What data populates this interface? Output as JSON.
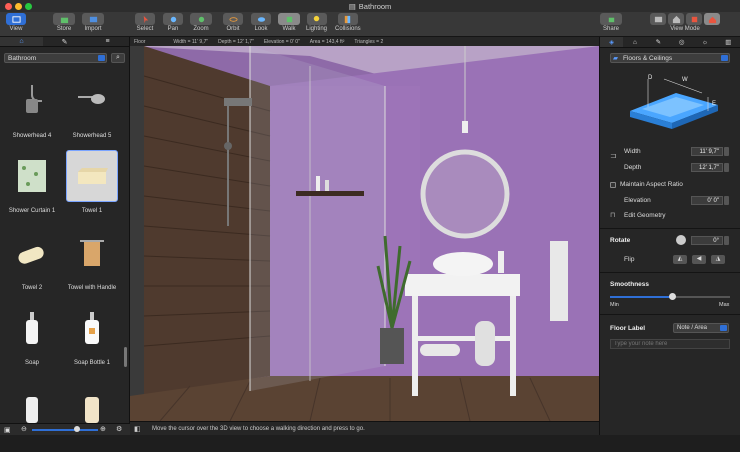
{
  "window": {
    "title": "Bathroom"
  },
  "toolbar": {
    "view": "View",
    "store": "Store",
    "import": "Import",
    "select": "Select",
    "pan": "Pan",
    "zoom": "Zoom",
    "orbit": "Orbit",
    "look": "Look",
    "walk": "Walk",
    "lighting": "Lighting",
    "collisions": "Collisions",
    "share": "Share",
    "viewmode": "View Mode"
  },
  "status": {
    "floor": "Floor",
    "width": "Width = 11' 9,7\"",
    "depth": "Depth = 12' 1,7\"",
    "elevation": "Elevation = 0' 0\"",
    "area": "Area = 143,4 ft²",
    "triangles": "Triangles = 2"
  },
  "library": {
    "category": "Bathroom",
    "items": [
      {
        "label": "Showerhead 4"
      },
      {
        "label": "Showerhead 5"
      },
      {
        "label": "Shower Curtain 1"
      },
      {
        "label": "Towel 1"
      },
      {
        "label": "Towel 2"
      },
      {
        "label": "Towel with Handle"
      },
      {
        "label": "Soap"
      },
      {
        "label": "Soap Bottle 1"
      }
    ]
  },
  "hint": "Move the cursor over the 3D view to choose a walking direction and press to go.",
  "inspector": {
    "category": "Floors & Ceilings",
    "diagram": {
      "d": "D",
      "w": "W",
      "e": "E"
    },
    "width_label": "Width",
    "width_value": "11' 9,7\"",
    "depth_label": "Depth",
    "depth_value": "12' 1,7\"",
    "aspect_label": "Maintain Aspect Ratio",
    "elevation_label": "Elevation",
    "elevation_value": "0' 0\"",
    "edit_geometry": "Edit Geometry",
    "rotate_label": "Rotate",
    "rotate_value": "0°",
    "flip_label": "Flip",
    "smoothness_label": "Smoothness",
    "smoothness_level": 0.52,
    "min_label": "Min",
    "max_label": "Max",
    "floor_label": "Floor Label",
    "floor_label_value": "Note / Area",
    "note_placeholder": "Type your note here"
  },
  "colors": {
    "accent": "#2f6fd6",
    "wall": "#9b6fb3",
    "wood": "#4f3a2e",
    "highlight": "#f0a040"
  }
}
